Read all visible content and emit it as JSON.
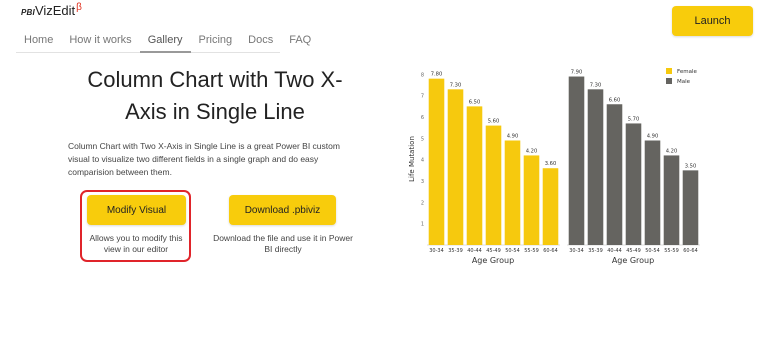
{
  "header": {
    "logo_prefix": "PBI",
    "logo_main": "VizEdit",
    "logo_beta": "β",
    "nav": [
      "Home",
      "How it works",
      "Gallery",
      "Pricing",
      "Docs",
      "FAQ"
    ],
    "active_nav": "Gallery",
    "launch_label": "Launch"
  },
  "main": {
    "title": "Column Chart with Two X-Axis in Single Line",
    "description": "Column Chart with Two X-Axis in Single Line is a great Power BI custom visual to visualize two different fields in a single graph and do easy comparision between them.",
    "modify_label": "Modify Visual",
    "modify_note": "Allows you to modify this view in our editor",
    "download_label": "Download .pbiviz",
    "download_note": "Download the file and use it in Power BI directly"
  },
  "colors": {
    "accent": "#f8cc0c",
    "highlight": "#e0242a"
  },
  "chart_data": {
    "type": "bar",
    "categories": [
      "30-34",
      "35-39",
      "40-44",
      "45-49",
      "50-54",
      "55-59",
      "60-64"
    ],
    "series": [
      {
        "name": "Female",
        "values": [
          7.8,
          7.3,
          6.5,
          5.6,
          4.9,
          4.2,
          3.6
        ],
        "color": "#f6c90e"
      },
      {
        "name": "Male",
        "values": [
          7.9,
          7.3,
          6.6,
          5.7,
          4.9,
          4.2,
          3.5
        ],
        "color": "#656460"
      }
    ],
    "value_labels": [
      [
        "7.80",
        "7.30",
        "6.50",
        "5.60",
        "4.90",
        "4.20",
        "3.60"
      ],
      [
        "7.90",
        "7.30",
        "6.60",
        "5.70",
        "4.90",
        "4.20",
        "3.50"
      ]
    ],
    "xlabel": "Age Group",
    "ylabel": "Life Mutation",
    "yticks": [
      "1",
      "2",
      "3",
      "4",
      "5",
      "6",
      "7",
      "8"
    ],
    "ylim": [
      0,
      8.3
    ],
    "grid": false,
    "legend": "top-right"
  }
}
